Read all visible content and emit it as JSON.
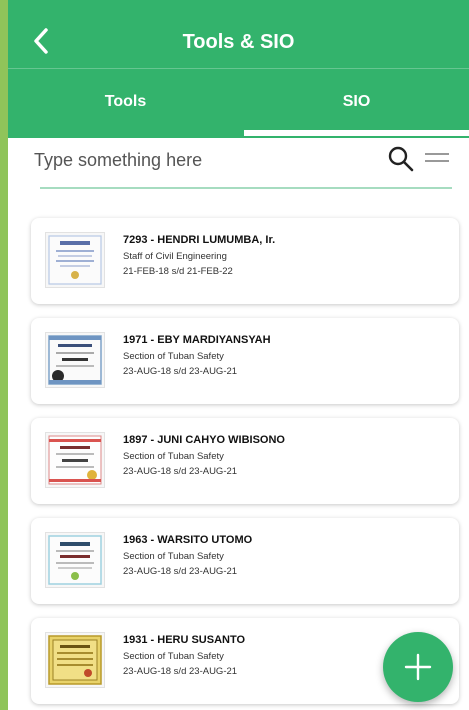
{
  "app": {
    "title": "Tools & SIO"
  },
  "tabs": [
    {
      "label": "Tools",
      "active": false
    },
    {
      "label": "SIO",
      "active": true
    }
  ],
  "search": {
    "placeholder": "Type something here"
  },
  "colors": {
    "primary": "#33b36c",
    "tab_indicator": "#ffffff",
    "search_underline": "#a6dcc0"
  },
  "icons": {
    "back": "chevron-left-icon",
    "search": "search-icon",
    "menu": "menu-icon",
    "add": "plus-icon"
  },
  "records": [
    {
      "title": "7293 - HENDRI LUMUMBA, Ir.",
      "subtitle": "Staff of Civil Engineering",
      "dates": "21-FEB-18 s/d 21-FEB-22",
      "thumbnail": "certificate-thumbnail"
    },
    {
      "title": "1971 - EBY MARDIYANSYAH",
      "subtitle": "Section of Tuban Safety",
      "dates": "23-AUG-18 s/d 23-AUG-21",
      "thumbnail": "certificate-thumbnail"
    },
    {
      "title": "1897 - JUNI CAHYO WIBISONO",
      "subtitle": "Section of Tuban Safety",
      "dates": "23-AUG-18 s/d 23-AUG-21",
      "thumbnail": "certificate-thumbnail"
    },
    {
      "title": "1963 - WARSITO UTOMO",
      "subtitle": "Section of Tuban Safety",
      "dates": "23-AUG-18 s/d 23-AUG-21",
      "thumbnail": "certificate-thumbnail"
    },
    {
      "title": "1931 - HERU SUSANTO",
      "subtitle": "Section of Tuban Safety",
      "dates": "23-AUG-18 s/d 23-AUG-21",
      "thumbnail": "certificate-thumbnail"
    }
  ]
}
